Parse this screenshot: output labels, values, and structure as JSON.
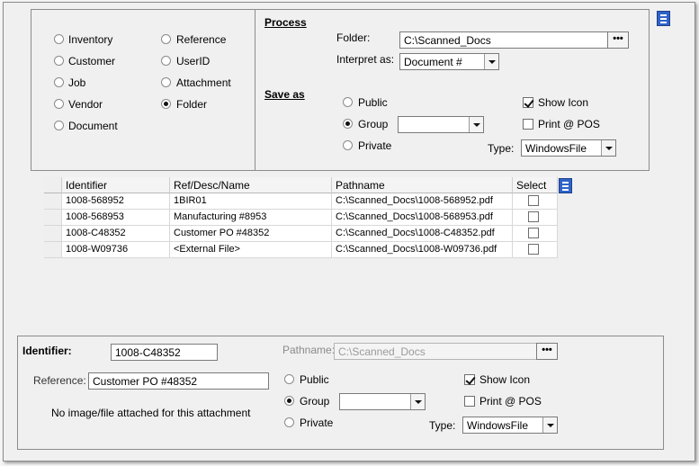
{
  "type_options": {
    "left": [
      {
        "label": "Inventory",
        "selected": false
      },
      {
        "label": "Customer",
        "selected": false
      },
      {
        "label": "Job",
        "selected": false
      },
      {
        "label": "Vendor",
        "selected": false
      },
      {
        "label": "Document",
        "selected": false
      }
    ],
    "right": [
      {
        "label": "Reference",
        "selected": false
      },
      {
        "label": "UserID",
        "selected": false
      },
      {
        "label": "Attachment",
        "selected": false
      },
      {
        "label": "Folder",
        "selected": true
      }
    ]
  },
  "process": {
    "heading": "Process",
    "folder_label": "Folder:",
    "folder_value": "C:\\Scanned_Docs",
    "browse_label": "•••",
    "interpret_label": "Interpret as:",
    "interpret_value": "Document #"
  },
  "save_as": {
    "heading": "Save as",
    "public_label": "Public",
    "group_label": "Group",
    "private_label": "Private",
    "selected": "Group",
    "group_value": "",
    "show_icon_label": "Show Icon",
    "show_icon_checked": true,
    "print_pos_label": "Print @ POS",
    "print_pos_checked": false,
    "type_label": "Type:",
    "type_value": "WindowsFile"
  },
  "grid": {
    "columns": [
      "Identifier",
      "Ref/Desc/Name",
      "Pathname",
      "Select"
    ],
    "rows": [
      {
        "identifier": "1008-568952",
        "ref": "1BIR01",
        "pathname": "C:\\Scanned_Docs\\1008-568952.pdf",
        "selected": false
      },
      {
        "identifier": "1008-568953",
        "ref": "Manufacturing #8953",
        "pathname": "C:\\Scanned_Docs\\1008-568953.pdf",
        "selected": false
      },
      {
        "identifier": "1008-C48352",
        "ref": "Customer PO #48352",
        "pathname": "C:\\Scanned_Docs\\1008-C48352.pdf",
        "selected": false
      },
      {
        "identifier": "1008-W09736",
        "ref": "<External File>",
        "pathname": "C:\\Scanned_Docs\\1008-W09736.pdf",
        "selected": false
      }
    ]
  },
  "detail": {
    "identifier_label": "Identifier:",
    "identifier_value": "1008-C48352",
    "pathname_label": "Pathname:",
    "pathname_value": "C:\\Scanned_Docs",
    "browse_label": "•••",
    "reference_label": "Reference:",
    "reference_value": "Customer PO #48352",
    "no_image_text": "No image/file attached for this attachment",
    "public_label": "Public",
    "group_label": "Group",
    "private_label": "Private",
    "selected": "Group",
    "group_value": "",
    "show_icon_label": "Show Icon",
    "show_icon_checked": true,
    "print_pos_label": "Print @ POS",
    "print_pos_checked": false,
    "type_label": "Type:",
    "type_value": "WindowsFile"
  },
  "colors": {
    "menu_icon": "#2f63c8",
    "panel_bg": "#f0f0f0"
  }
}
